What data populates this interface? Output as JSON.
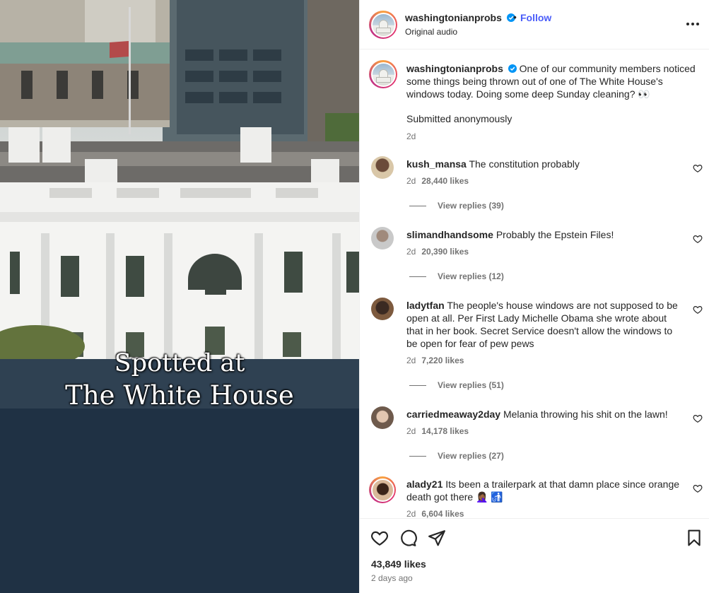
{
  "media": {
    "overlay_line1": "Spotted at",
    "overlay_line2": "The White House"
  },
  "header": {
    "username": "washingtonianprobs",
    "separator": "•",
    "follow_label": "Follow",
    "audio": "Original audio"
  },
  "caption": {
    "username": "washingtonianprobs",
    "text": "One of our community members noticed some things being thrown out of one of The White House's windows today. Doing some deep Sunday cleaning? 👀",
    "submitted": "Submitted anonymously",
    "time": "2d"
  },
  "comments": [
    {
      "username": "kush_mansa",
      "text": "The constitution probably",
      "time": "2d",
      "likes": "28,440 likes",
      "replies": "View replies (39)"
    },
    {
      "username": "slimandhandsome",
      "text": "Probably the Epstein Files!",
      "time": "2d",
      "likes": "20,390 likes",
      "replies": "View replies (12)"
    },
    {
      "username": "ladytfan",
      "text": "The people's house windows are not supposed to be open at all. Per First Lady Michelle Obama she wrote about that in her book. Secret Service doesn't allow the windows to be open for fear of pew pews",
      "time": "2d",
      "likes": "7,220 likes",
      "replies": "View replies (51)"
    },
    {
      "username": "carriedmeaway2day",
      "text": "Melania throwing his shit on the lawn!",
      "time": "2d",
      "likes": "14,178 likes",
      "replies": "View replies (27)"
    },
    {
      "username": "alady21",
      "text": "Its been a trailerpark at that damn place since orange death got there 🤦🏾‍♀️ 🚮",
      "time": "2d",
      "likes": "6,604 likes"
    }
  ],
  "footer": {
    "likes_total": "43,849 likes",
    "posted": "2 days ago"
  },
  "icons": {
    "verified": "verified-badge-icon",
    "more": "more-options-icon",
    "like": "heart-icon",
    "comment": "comment-bubble-icon",
    "share": "paper-plane-icon",
    "save": "bookmark-icon"
  },
  "colors": {
    "accent": "#4a5df9",
    "verified": "#0095f6",
    "muted": "#737373",
    "text": "#262626"
  }
}
